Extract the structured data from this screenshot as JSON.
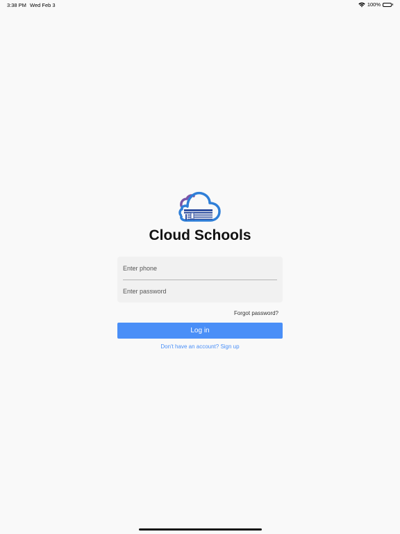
{
  "status_bar": {
    "time": "3:38 PM",
    "date": "Wed Feb 3",
    "battery": "100%",
    "icons": [
      "wifi-icon",
      "battery-icon"
    ]
  },
  "app": {
    "title": "Cloud Schools",
    "logo_icon": "cloud-book-logo",
    "colors": {
      "accent": "#4a8ff7",
      "logo_blue": "#2f7fd8",
      "logo_purple": "#7a55a8"
    }
  },
  "login": {
    "phone_placeholder": "Enter phone",
    "phone_value": "",
    "password_placeholder": "Enter password",
    "password_value": "",
    "forgot_label": "Forgot password?",
    "login_label": "Log in",
    "signup_label": "Don't have an account? Sign up"
  }
}
